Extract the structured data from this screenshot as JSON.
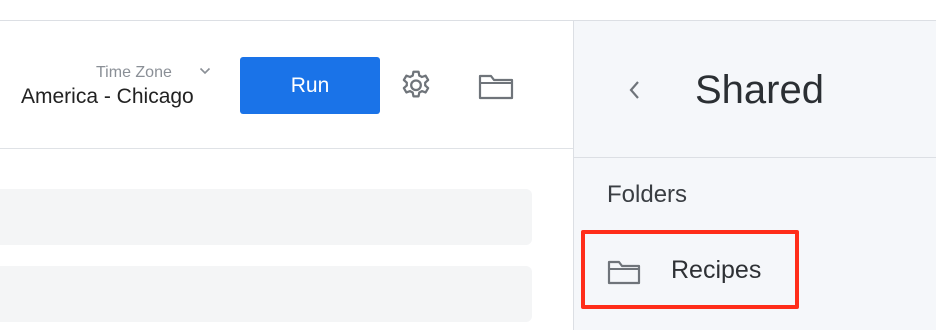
{
  "toolbar": {
    "timezone_label": "Time Zone",
    "timezone_value": "America - Chicago",
    "run_label": "Run",
    "icons": [
      "chevron-down-icon",
      "gear-icon",
      "folder-icon"
    ]
  },
  "side_panel": {
    "title": "Shared",
    "back_icon": "chevron-left-icon",
    "section_label": "Folders",
    "folders": [
      {
        "label": "Recipes",
        "icon": "folder-icon",
        "highlighted": true
      }
    ]
  },
  "colors": {
    "accent": "#1a73e8",
    "highlight": "#ff2d1a",
    "panel_bg": "#f5f7fa",
    "field_bg": "#f4f5f6"
  }
}
